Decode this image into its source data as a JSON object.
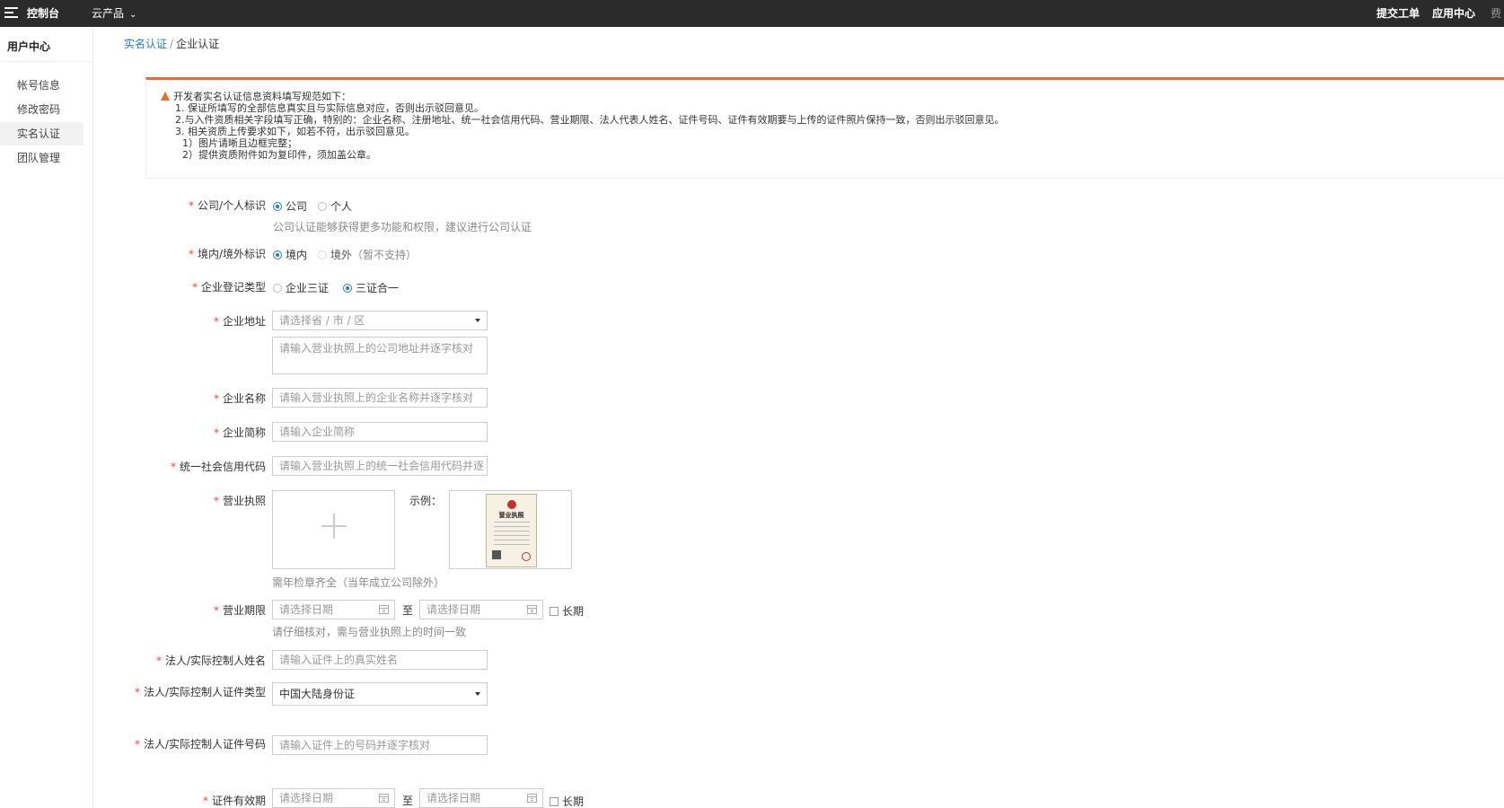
{
  "topbar": {
    "brand": "控制台",
    "products": "云产品",
    "submit_ticket": "提交工单",
    "app_center": "应用中心",
    "cut_text": "费"
  },
  "sidebar": {
    "title": "用户中心",
    "items": [
      {
        "label": "帐号信息"
      },
      {
        "label": "修改密码"
      },
      {
        "label": "实名认证"
      },
      {
        "label": "团队管理"
      }
    ]
  },
  "breadcrumb": {
    "parent": "实名认证",
    "separator": "/",
    "current": "企业认证"
  },
  "notice": {
    "heading": "开发者实名认证信息资料填写规范如下：",
    "lines": [
      "1. 保证所填写的全部信息真实且与实际信息对应，否则出示驳回意见。",
      "2.与入件资质相关字段填写正确，特别的：企业名称、注册地址、统一社会信用代码、营业期限、法人代表人姓名、证件号码、证件有效期要与上传的证件照片保持一致，否则出示驳回意见。",
      "3. 相关资质上传要求如下，如若不符，出示驳回意见。",
      "1）图片请晰且边框完整；",
      "2）提供资质附件如为复印件，须加盖公章。"
    ]
  },
  "form": {
    "identity": {
      "label": "公司/个人标识",
      "options": [
        "公司",
        "个人"
      ],
      "selected": "公司",
      "help": "公司认证能够获得更多功能和权限，建议进行公司认证"
    },
    "region": {
      "label": "境内/境外标识",
      "options": [
        "境内",
        "境外"
      ],
      "disabled_hint": "（暂不支持）",
      "selected": "境内"
    },
    "reg_type": {
      "label": "企业登记类型",
      "options": [
        "企业三证",
        "三证合一"
      ],
      "selected": "三证合一"
    },
    "address": {
      "label": "企业地址",
      "select_placeholder": "请选择省 / 市 / 区",
      "detail_placeholder": "请输入营业执照上的公司地址并逐字核对"
    },
    "name": {
      "label": "企业名称",
      "placeholder": "请输入营业执照上的企业名称并逐字核对"
    },
    "short_name": {
      "label": "企业简称",
      "placeholder": "请输入企业简称"
    },
    "credit_code": {
      "label": "统一社会信用代码",
      "placeholder": "请输入营业执照上的统一社会信用代码并逐"
    },
    "license": {
      "label": "营业执照",
      "example_label": "示例：",
      "example_title": "营业执照",
      "help": "需年检章齐全（当年成立公司除外）"
    },
    "business_term": {
      "label": "营业期限",
      "start_placeholder": "请选择日期",
      "to": "至",
      "end_placeholder": "请选择日期",
      "long_term": "长期",
      "help": "请仔细核对，需与营业执照上的时间一致"
    },
    "legal_name": {
      "label": "法人/实际控制人姓名",
      "placeholder": "请输入证件上的真实姓名"
    },
    "id_type": {
      "label": "法人/实际控制人证件类型",
      "value": "中国大陆身份证"
    },
    "id_number": {
      "label": "法人/实际控制人证件号码",
      "placeholder": "请输入证件上的号码并逐字核对"
    },
    "id_validity": {
      "label": "证件有效期",
      "start_placeholder": "请选择日期",
      "to": "至",
      "end_placeholder": "请选择日期",
      "long_term": "长期"
    }
  },
  "colors": {
    "topbar": "#2b2b2b",
    "accent": "#1e7ad1",
    "notice_border": "#f06925",
    "required": "#f04134"
  }
}
